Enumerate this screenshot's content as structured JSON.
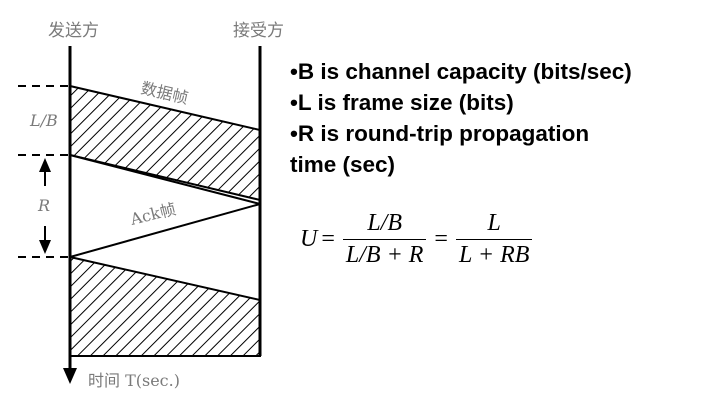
{
  "diagram": {
    "sender_label": "发送方",
    "receiver_label": "接受方",
    "data_frame_label": "数据帧",
    "ack_frame_label": "Ack帧",
    "transmit_time_label": "L/B",
    "rtt_label": "R",
    "time_axis_label": "时间 T(sec.)"
  },
  "bullets": [
    "•B is channel capacity (bits/sec)",
    "•L is frame size (bits)",
    "•R is round-trip propagation",
    "time (sec)"
  ],
  "formula": {
    "lhs": "U",
    "equals": "=",
    "frac1_num": "L/B",
    "frac1_den": "L/B + R",
    "equals2": "=",
    "frac2_num": "L",
    "frac2_den": "L + RB"
  }
}
